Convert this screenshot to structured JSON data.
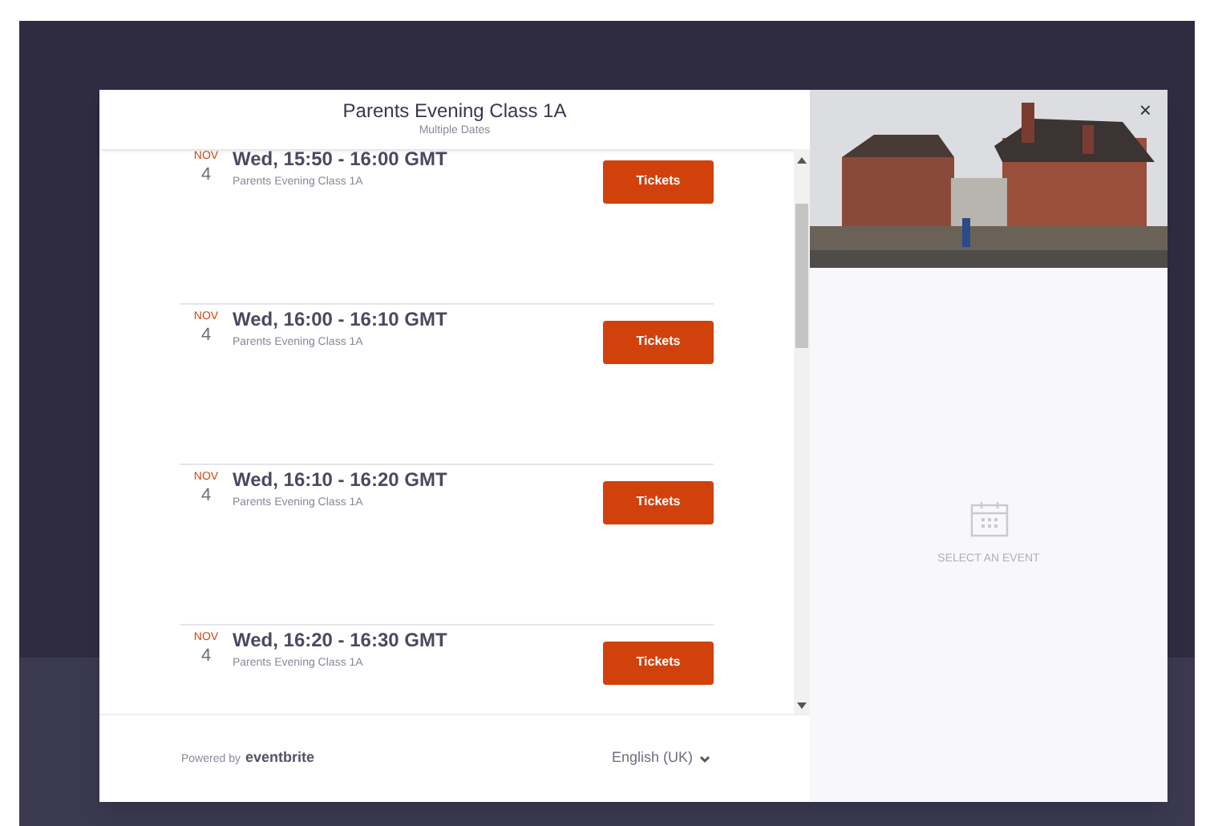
{
  "header": {
    "title": "Parents Evening Class 1A",
    "subtitle": "Multiple Dates"
  },
  "events": [
    {
      "month": "NOV",
      "day": "4",
      "time": "Wed, 15:50 - 16:00 GMT",
      "name": "Parents Evening Class 1A",
      "button": "Tickets"
    },
    {
      "month": "NOV",
      "day": "4",
      "time": "Wed, 16:00 - 16:10 GMT",
      "name": "Parents Evening Class 1A",
      "button": "Tickets"
    },
    {
      "month": "NOV",
      "day": "4",
      "time": "Wed, 16:10 - 16:20 GMT",
      "name": "Parents Evening Class 1A",
      "button": "Tickets"
    },
    {
      "month": "NOV",
      "day": "4",
      "time": "Wed, 16:20 - 16:30 GMT",
      "name": "Parents Evening Class 1A",
      "button": "Tickets"
    }
  ],
  "footer": {
    "powered_by": "Powered by",
    "brand": "eventbrite",
    "language": "English (UK)"
  },
  "side_panel": {
    "close": "×",
    "empty_message": "SELECT AN EVENT"
  }
}
